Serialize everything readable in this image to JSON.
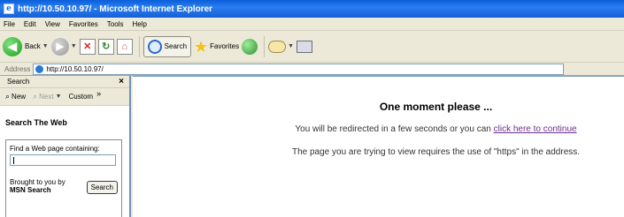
{
  "window": {
    "title": "http://10.50.10.97/ - Microsoft Internet Explorer"
  },
  "menu": [
    "File",
    "Edit",
    "View",
    "Favorites",
    "Tools",
    "Help"
  ],
  "toolbar": {
    "back_label": "Back",
    "search_label": "Search",
    "favorites_label": "Favorites"
  },
  "address": {
    "label": "Address",
    "value": "http://10.50.10.97/"
  },
  "sidepane": {
    "title": "Search",
    "close": "×",
    "new_label": "New",
    "next_label": "Next",
    "customize_label": "Custom",
    "more": "»",
    "heading": "Search The Web",
    "find_label": "Find a Web page containing:",
    "find_value": "",
    "brought_by": "Brought to you by",
    "provider": "MSN Search",
    "search_button": "Search"
  },
  "content": {
    "heading": "One moment please ...",
    "redirect_text": "You will be redirected in a few seconds or you can ",
    "redirect_link": "click here to continue",
    "requires_text": "The page you are trying to view requires the use of \"https\" in the address."
  }
}
